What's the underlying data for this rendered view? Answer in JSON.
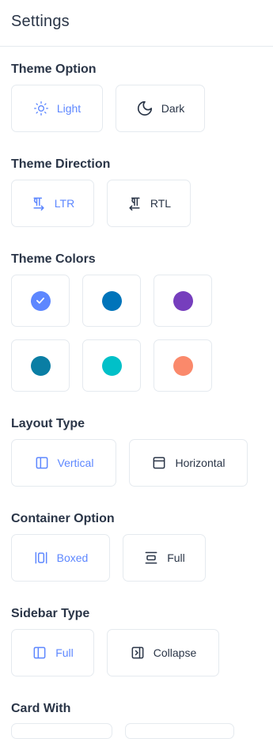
{
  "header": {
    "title": "Settings"
  },
  "theme_option": {
    "title": "Theme Option",
    "options": [
      {
        "label": "Light",
        "icon": "sun-icon",
        "active": true
      },
      {
        "label": "Dark",
        "icon": "moon-icon",
        "active": false
      }
    ]
  },
  "theme_direction": {
    "title": "Theme Direction",
    "options": [
      {
        "label": "LTR",
        "icon": "ltr-icon",
        "active": true
      },
      {
        "label": "RTL",
        "icon": "rtl-icon",
        "active": false
      }
    ]
  },
  "theme_colors": {
    "title": "Theme Colors",
    "colors": [
      "#5d87ff",
      "#0074ba",
      "#763ebd",
      "#0a7ea4",
      "#01c0c8",
      "#fa896b"
    ],
    "selected_index": 0
  },
  "layout_type": {
    "title": "Layout Type",
    "options": [
      {
        "label": "Vertical",
        "icon": "vertical-layout-icon",
        "active": true
      },
      {
        "label": "Horizontal",
        "icon": "horizontal-layout-icon",
        "active": false
      }
    ]
  },
  "container_option": {
    "title": "Container Option",
    "options": [
      {
        "label": "Boxed",
        "icon": "boxed-icon",
        "active": true
      },
      {
        "label": "Full",
        "icon": "full-width-icon",
        "active": false
      }
    ]
  },
  "sidebar_type": {
    "title": "Sidebar Type",
    "options": [
      {
        "label": "Full",
        "icon": "sidebar-full-icon",
        "active": true
      },
      {
        "label": "Collapse",
        "icon": "sidebar-collapse-icon",
        "active": false
      }
    ]
  },
  "card_with": {
    "title": "Card With"
  },
  "colors": {
    "accent": "#5d87ff",
    "text": "#2a3547",
    "border": "#e5eaef"
  }
}
